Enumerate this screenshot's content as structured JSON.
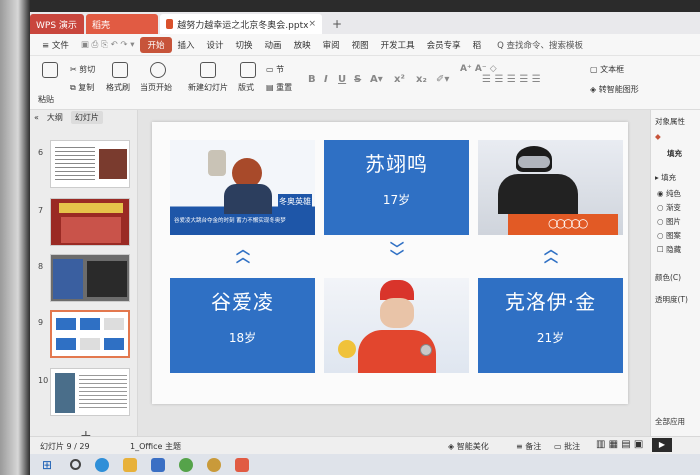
{
  "tabs": {
    "wps": "WPS 演示",
    "docer": "稻壳",
    "document": "越努力越幸运之北京冬奥会.pptx",
    "close": "×",
    "new_tab": "+"
  },
  "menubar": {
    "file": "≡ 文件",
    "items": [
      "开始",
      "插入",
      "设计",
      "切换",
      "动画",
      "放映",
      "审阅",
      "视图",
      "开发工具",
      "会员专享",
      "稻"
    ],
    "search": "Q 查找命令、搜索模板"
  },
  "ribbon": {
    "paste": "粘贴",
    "cut": "剪切",
    "copy": "复制",
    "format_painter": "格式刷",
    "play_from_current": "当页开始",
    "new_slide": "新建幻灯片",
    "layout": "版式",
    "section": "节",
    "reset": "重置",
    "text_box": "文本框",
    "smart_shape": "转智能图形"
  },
  "left_panel": {
    "tab_outline": "大纲",
    "tab_slides": "幻灯片",
    "collapse": "«",
    "slide_numbers": [
      "6",
      "7",
      "8",
      "9",
      "10"
    ],
    "add": "+"
  },
  "slide": {
    "athletes": [
      {
        "name": "苏翊鸣",
        "age": "17岁"
      },
      {
        "name": "谷爱凌",
        "age": "18岁"
      },
      {
        "name": "克洛伊·金",
        "age": "21岁"
      }
    ],
    "photo_caption": "谷爱凌大跳台夺金的时刻 蓄力不懈实现冬奥梦",
    "badge": "冬奥英雄"
  },
  "right_panel": {
    "title": "对象属性",
    "fill": "填充",
    "fill_header": "▸ 填充",
    "options": [
      "纯色",
      "渐变",
      "图片",
      "图案",
      "隐藏"
    ],
    "color": "颜色(C)",
    "transparency": "透明度(T)",
    "apply_all": "全部应用"
  },
  "status": {
    "slide_count": "幻灯片 9 / 29",
    "theme": "1_Office 主题",
    "smart_beautify": "智能美化",
    "notes": "备注",
    "comments": "批注"
  },
  "colors": {
    "accent": "#c7543a",
    "slide_blue": "#2f70c4"
  }
}
